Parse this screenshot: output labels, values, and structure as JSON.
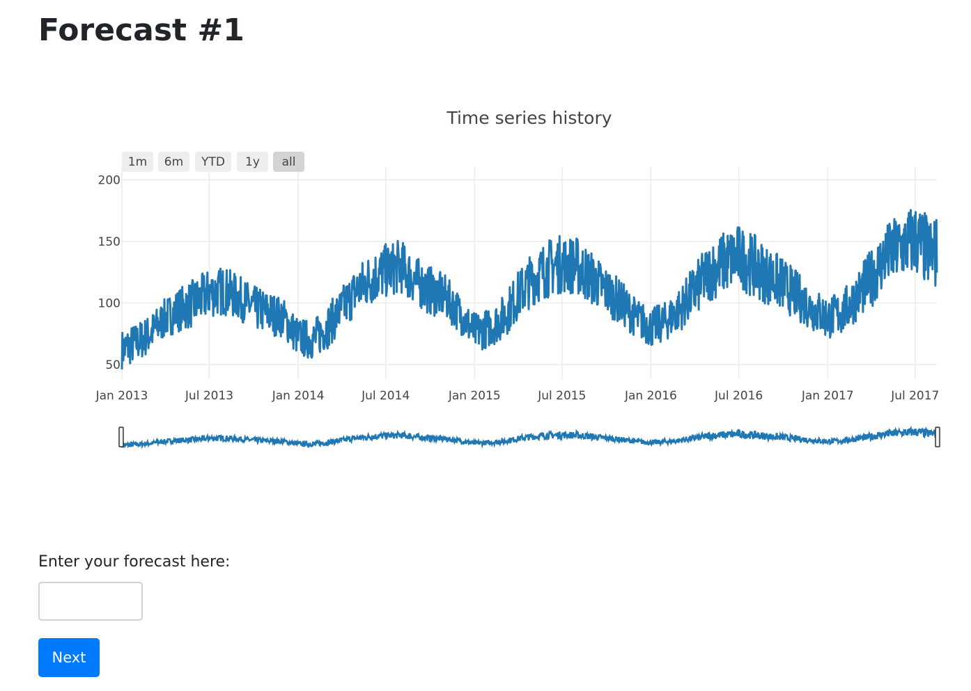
{
  "page": {
    "title": "Forecast #1"
  },
  "range_selector": {
    "buttons": [
      {
        "label": "1m",
        "active": false
      },
      {
        "label": "6m",
        "active": false
      },
      {
        "label": "YTD",
        "active": false
      },
      {
        "label": "1y",
        "active": false
      },
      {
        "label": "all",
        "active": true
      }
    ]
  },
  "chart_data": {
    "type": "line",
    "title": "Time series history",
    "xlabel": "",
    "ylabel": "",
    "xlim": [
      "2013-01-01",
      "2017-08-15"
    ],
    "ylim": [
      38,
      202
    ],
    "y_ticks": [
      50,
      100,
      150,
      200
    ],
    "x_ticks": [
      {
        "date": "2013-01-01",
        "label": "Jan 2013"
      },
      {
        "date": "2013-07-01",
        "label": "Jul 2013"
      },
      {
        "date": "2014-01-01",
        "label": "Jan 2014"
      },
      {
        "date": "2014-07-01",
        "label": "Jul 2014"
      },
      {
        "date": "2015-01-01",
        "label": "Jan 2015"
      },
      {
        "date": "2015-07-01",
        "label": "Jul 2015"
      },
      {
        "date": "2016-01-01",
        "label": "Jan 2016"
      },
      {
        "date": "2016-07-01",
        "label": "Jul 2016"
      },
      {
        "date": "2017-01-01",
        "label": "Jan 2017"
      },
      {
        "date": "2017-07-01",
        "label": "Jul 2017"
      }
    ],
    "grid": true,
    "rangeslider": true,
    "series": [
      {
        "color": "#1f77b4",
        "x": [
          "2013-01-01",
          "2013-02-01",
          "2013-03-01",
          "2013-04-01",
          "2013-05-01",
          "2013-06-01",
          "2013-07-01",
          "2013-08-01",
          "2013-09-01",
          "2013-10-01",
          "2013-11-01",
          "2013-12-01",
          "2014-01-01",
          "2014-02-01",
          "2014-03-01",
          "2014-04-01",
          "2014-05-01",
          "2014-06-01",
          "2014-07-01",
          "2014-08-01",
          "2014-09-01",
          "2014-10-01",
          "2014-11-01",
          "2014-12-01",
          "2015-01-01",
          "2015-02-01",
          "2015-03-01",
          "2015-04-01",
          "2015-05-01",
          "2015-06-01",
          "2015-07-01",
          "2015-08-01",
          "2015-09-01",
          "2015-10-01",
          "2015-11-01",
          "2015-12-01",
          "2016-01-01",
          "2016-02-01",
          "2016-03-01",
          "2016-04-01",
          "2016-05-01",
          "2016-06-01",
          "2016-07-01",
          "2016-08-01",
          "2016-09-01",
          "2016-10-01",
          "2016-11-01",
          "2016-12-01",
          "2017-01-01",
          "2017-02-01",
          "2017-03-01",
          "2017-04-01",
          "2017-05-01",
          "2017-06-01",
          "2017-07-01",
          "2017-08-01"
        ],
        "y": [
          62,
          68,
          75,
          88,
          95,
          100,
          108,
          110,
          104,
          96,
          92,
          88,
          72,
          70,
          80,
          95,
          110,
          120,
          126,
          130,
          118,
          110,
          105,
          92,
          76,
          80,
          88,
          106,
          120,
          128,
          132,
          130,
          120,
          110,
          100,
          88,
          80,
          85,
          95,
          110,
          125,
          133,
          138,
          130,
          122,
          115,
          105,
          95,
          88,
          92,
          105,
          120,
          138,
          145,
          152,
          140
        ],
        "amplitude": [
          16,
          16,
          16,
          16,
          18,
          20,
          20,
          20,
          18,
          18,
          18,
          16,
          16,
          16,
          18,
          18,
          20,
          22,
          22,
          22,
          20,
          20,
          18,
          16,
          16,
          16,
          18,
          20,
          22,
          24,
          24,
          24,
          22,
          20,
          18,
          16,
          16,
          16,
          18,
          22,
          24,
          26,
          26,
          26,
          24,
          22,
          20,
          18,
          18,
          18,
          20,
          24,
          26,
          28,
          30,
          30
        ]
      }
    ]
  },
  "forecast": {
    "label": "Enter your forecast here:",
    "input_value": "",
    "input_placeholder": ""
  },
  "actions": {
    "next_label": "Next",
    "next_color": "#007bff"
  }
}
